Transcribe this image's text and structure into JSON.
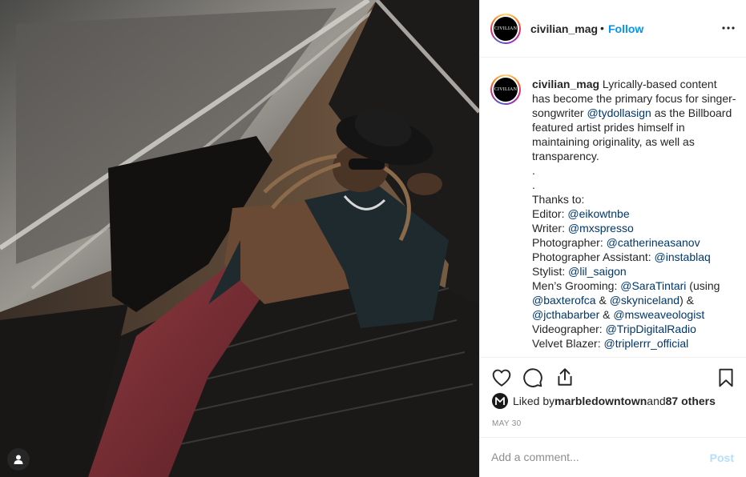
{
  "account": {
    "username": "civilian_mag",
    "avatar_text": "CIVILIAN",
    "follow_label": "Follow",
    "separator": "•"
  },
  "caption": {
    "username": "civilian_mag",
    "intro_a": " Lyrically-based content has become the primary focus for singer-songwriter ",
    "intro_mention": "@tydollasign",
    "intro_b": " as the Billboard featured artist prides himself in maintaining originality, as well as transparency.",
    "dot1": ".",
    "dot2": ".",
    "thanks": "Thanks to:",
    "credits": [
      {
        "role": "Editor: ",
        "handle": "@eikowtnbe"
      },
      {
        "role": "Writer: ",
        "handle": "@mxspresso"
      },
      {
        "role": "Photographer: ",
        "handle": "@catherineasanov"
      },
      {
        "role": "Photographer Assistant: ",
        "handle": "@instablaq"
      },
      {
        "role": "Stylist: ",
        "handle": "@lil_saigon"
      }
    ],
    "grooming": {
      "role": "Men’s Grooming: ",
      "h1": "@SaraTintari",
      "t1": " (using ",
      "h2": "@baxterofca",
      "t2": " & ",
      "h3": "@skyniceland",
      "t3": ") & ",
      "h4": "@jcthabarber",
      "t4": " & ",
      "h5": "@msweaveologist"
    },
    "credits2": [
      {
        "role": "Videographer: ",
        "handle": "@TripDigitalRadio"
      },
      {
        "role": "Velvet Blazer: ",
        "handle": "@triplerrr_official"
      }
    ]
  },
  "likes": {
    "prefix": "Liked by ",
    "liker": "marbledowntown",
    "middle": " and ",
    "others": "87 others"
  },
  "date": "MAY 30",
  "comment_box": {
    "placeholder": "Add a comment...",
    "post_label": "Post"
  },
  "colors": {
    "accent": "#0095f6",
    "mention": "#00376b",
    "muted": "#8e8e8e",
    "post_disabled": "#b2dffc"
  },
  "icons": [
    "user-tag-icon",
    "more-options-icon",
    "heart-icon",
    "comment-icon",
    "share-icon",
    "bookmark-icon"
  ]
}
